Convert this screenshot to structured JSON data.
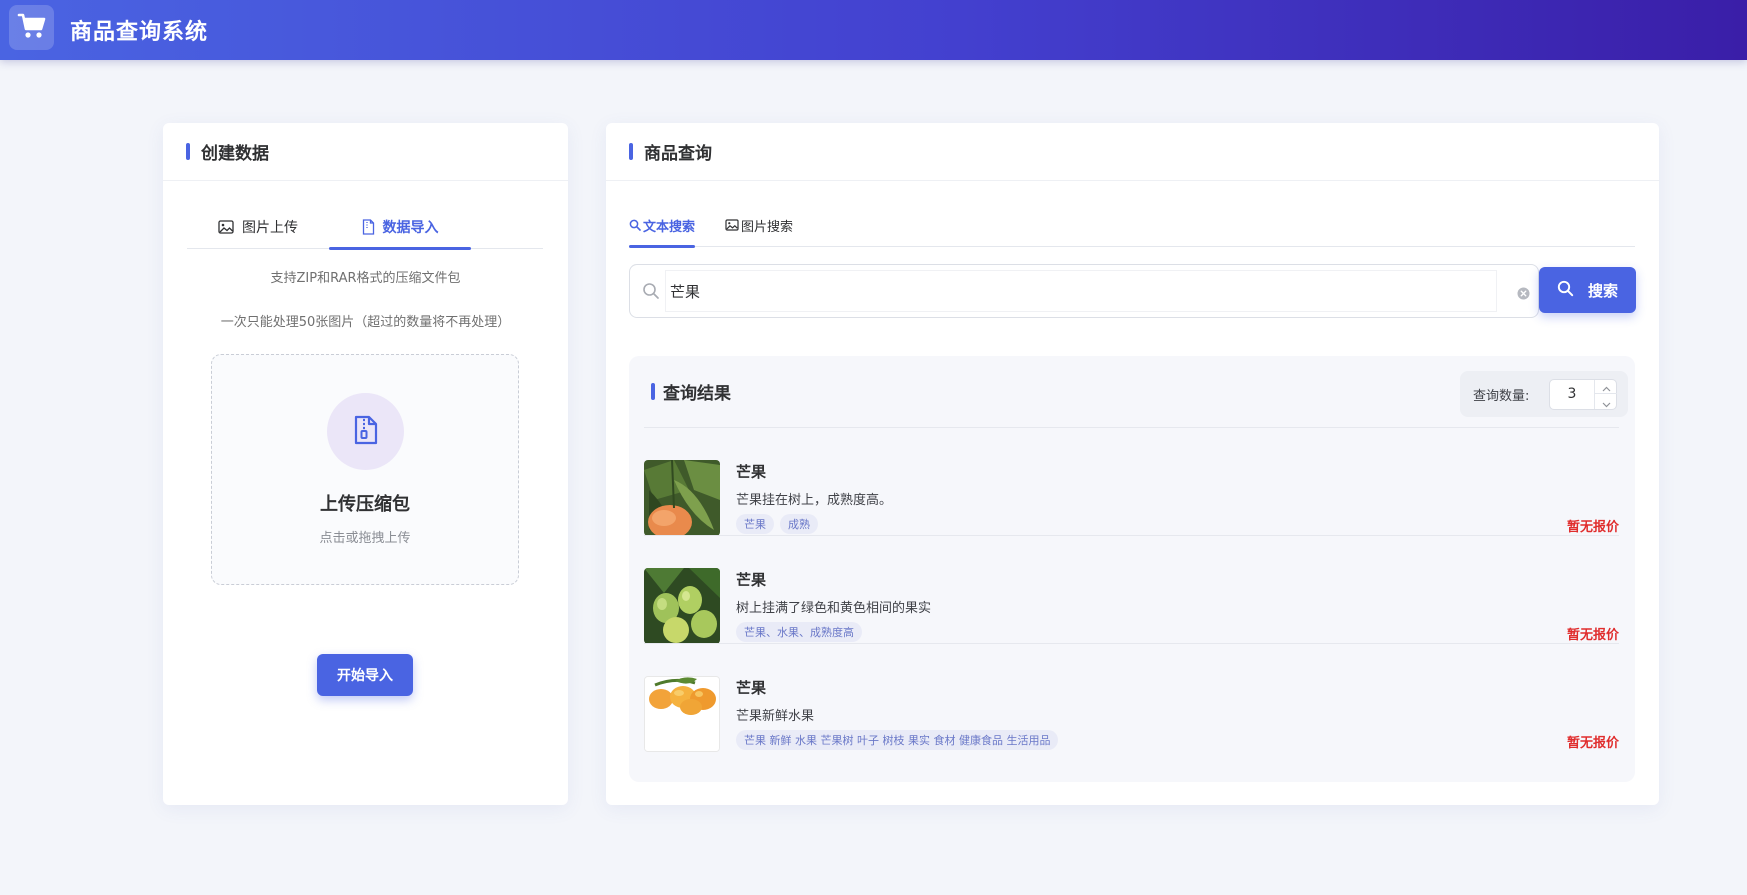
{
  "header": {
    "title": "商品查询系统",
    "logo_icon": "shopping-cart-icon"
  },
  "create_panel": {
    "title": "创建数据",
    "tabs": [
      {
        "label": "图片上传",
        "icon": "image-icon",
        "active": false
      },
      {
        "label": "数据导入",
        "icon": "file-icon",
        "active": true
      }
    ],
    "hint_formats": "支持ZIP和RAR格式的压缩文件包",
    "hint_limit": "一次只能处理50张图片（超过的数量将不再处理）",
    "dropzone": {
      "title": "上传压缩包",
      "subtitle": "点击或拖拽上传",
      "icon": "zip-file-icon"
    },
    "import_button": "开始导入"
  },
  "query_panel": {
    "title": "商品查询",
    "tabs": [
      {
        "label": "文本搜索",
        "icon": "search-icon",
        "active": true
      },
      {
        "label": "图片搜索",
        "icon": "image-icon",
        "active": false
      }
    ],
    "search": {
      "value": "芒果",
      "placeholder": "",
      "button_label": "搜索"
    },
    "results": {
      "title": "查询结果",
      "count_label": "查询数量:",
      "count_value": "3",
      "items": [
        {
          "name": "芒果",
          "description": "芒果挂在树上，成熟度高。",
          "tags": [
            "芒果",
            "成熟"
          ],
          "price": "暂无报价",
          "thumb": "mango-on-tree"
        },
        {
          "name": "芒果",
          "description": "树上挂满了绿色和黄色相间的果实",
          "tags": [
            "芒果、水果、成熟度高"
          ],
          "price": "暂无报价",
          "thumb": "green-mangoes-cluster"
        },
        {
          "name": "芒果",
          "description": "芒果新鲜水果",
          "tags": [
            "芒果 新鲜 水果 芒果树 叶子 树枝 果实 食材 健康食品 生活用品"
          ],
          "price": "暂无报价",
          "thumb": "yellow-mangoes"
        }
      ]
    }
  },
  "colors": {
    "accent": "#4a64e2",
    "price": "#e02d2d",
    "header_end": "#3a1ea8"
  }
}
